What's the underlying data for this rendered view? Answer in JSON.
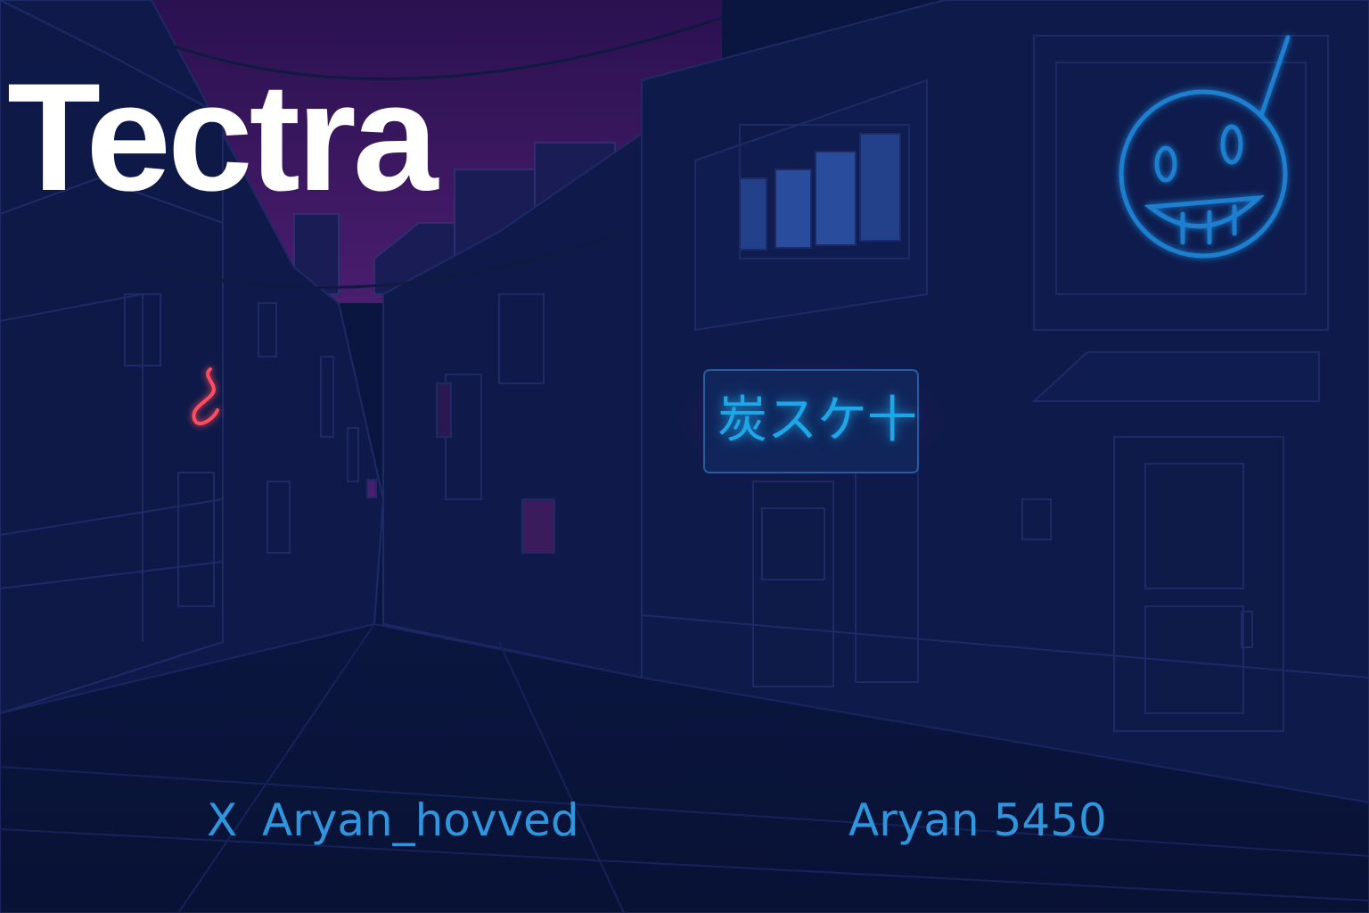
{
  "brand": {
    "title": "Tectra"
  },
  "sign": {
    "text": "炭スケ十"
  },
  "social": {
    "x_icon_glyph": "X",
    "x_handle": "Aryan_hovved",
    "other_handle": "Aryan 5450"
  },
  "colors": {
    "background": "#0b1640",
    "sky": "#3a1760",
    "neon_blue": "#1ea7e8",
    "neon_red": "#ff4d5e",
    "handle_text": "#2f95dd",
    "title_text": "#ffffff"
  },
  "icons": [
    "x-icon",
    "smiley-neon-sign-icon",
    "red-neon-squiggle-icon"
  ]
}
